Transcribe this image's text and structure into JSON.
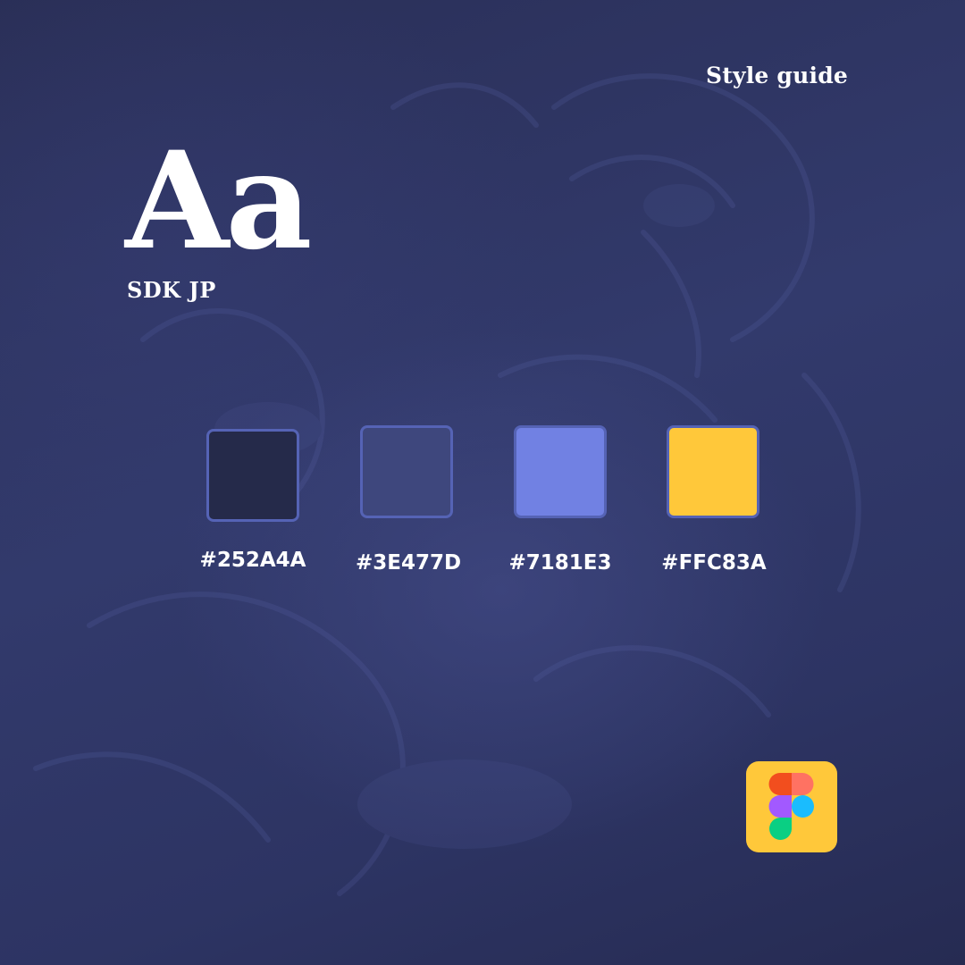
{
  "header": {
    "title": "Style guide"
  },
  "typography": {
    "specimen": "Aa",
    "font_name": "SDK JP"
  },
  "palette": {
    "colors": [
      {
        "hex": "#252A4A",
        "label": "#252A4A"
      },
      {
        "hex": "#3E477D",
        "label": "#3E477D"
      },
      {
        "hex": "#7181E3",
        "label": "#7181E3"
      },
      {
        "hex": "#FFC83A",
        "label": "#FFC83A"
      }
    ],
    "border_color": "#5563B5"
  },
  "badge": {
    "icon": "figma-logo-icon",
    "background": "#FFC83A",
    "logo_colors": [
      "#F24E1E",
      "#FF7262",
      "#A259FF",
      "#1ABCFE",
      "#0ACF83"
    ]
  }
}
